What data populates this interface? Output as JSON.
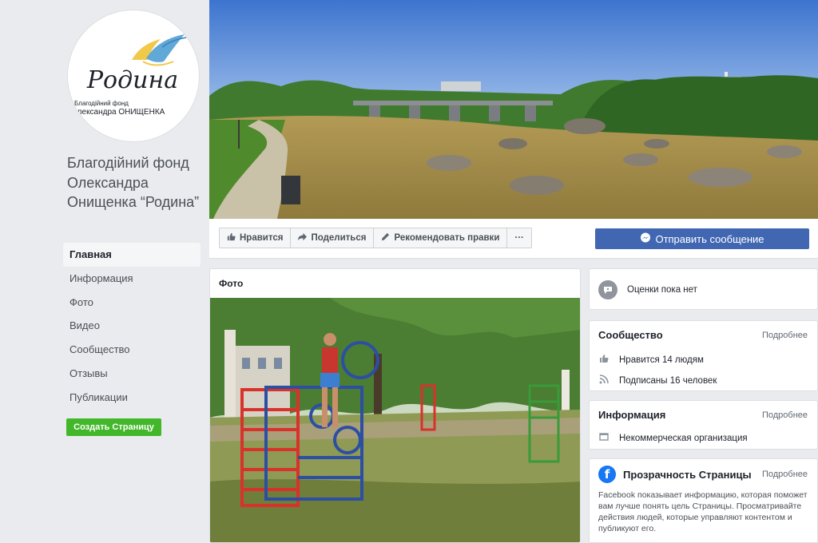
{
  "page": {
    "name": "Благодійний фонд Олександра Онищенка “Родина”",
    "logo": {
      "script_text": "Родина",
      "line1": "Благодійний фонд",
      "line2": "Олександра ОНИЩЕНКА"
    }
  },
  "nav": {
    "items": [
      "Главная",
      "Информация",
      "Фото",
      "Видео",
      "Сообщество",
      "Отзывы",
      "Публикации"
    ],
    "active_index": 0,
    "create_page": "Создать Страницу"
  },
  "actions": {
    "like": "Нравится",
    "share": "Поделиться",
    "suggest": "Рекомендовать правки",
    "more": "···",
    "send_message": "Отправить сообщение"
  },
  "photos": {
    "title": "Фото"
  },
  "ratings": {
    "text": "Оценки пока нет"
  },
  "community": {
    "title": "Сообщество",
    "more": "Подробнее",
    "likes": "Нравится 14 людям",
    "follows": "Подписаны 16 человек"
  },
  "info": {
    "title": "Информация",
    "more": "Подробнее",
    "category": "Некоммерческая организация"
  },
  "transparency": {
    "title": "Прозрачность Страницы",
    "more": "Подробнее",
    "text": "Facebook показывает информацию, которая поможет вам лучше понять цель Страницы. Просматривайте действия людей, которые управляют контентом и публикуют его."
  },
  "colors": {
    "facebook_blue": "#4267b2",
    "create_green": "#42b72a",
    "background": "#e9ebee"
  },
  "icons": [
    "thumbs-up-icon",
    "share-icon",
    "pencil-icon",
    "messenger-icon",
    "ratings-icon",
    "like-icon",
    "rss-icon",
    "flag-icon",
    "facebook-icon"
  ]
}
